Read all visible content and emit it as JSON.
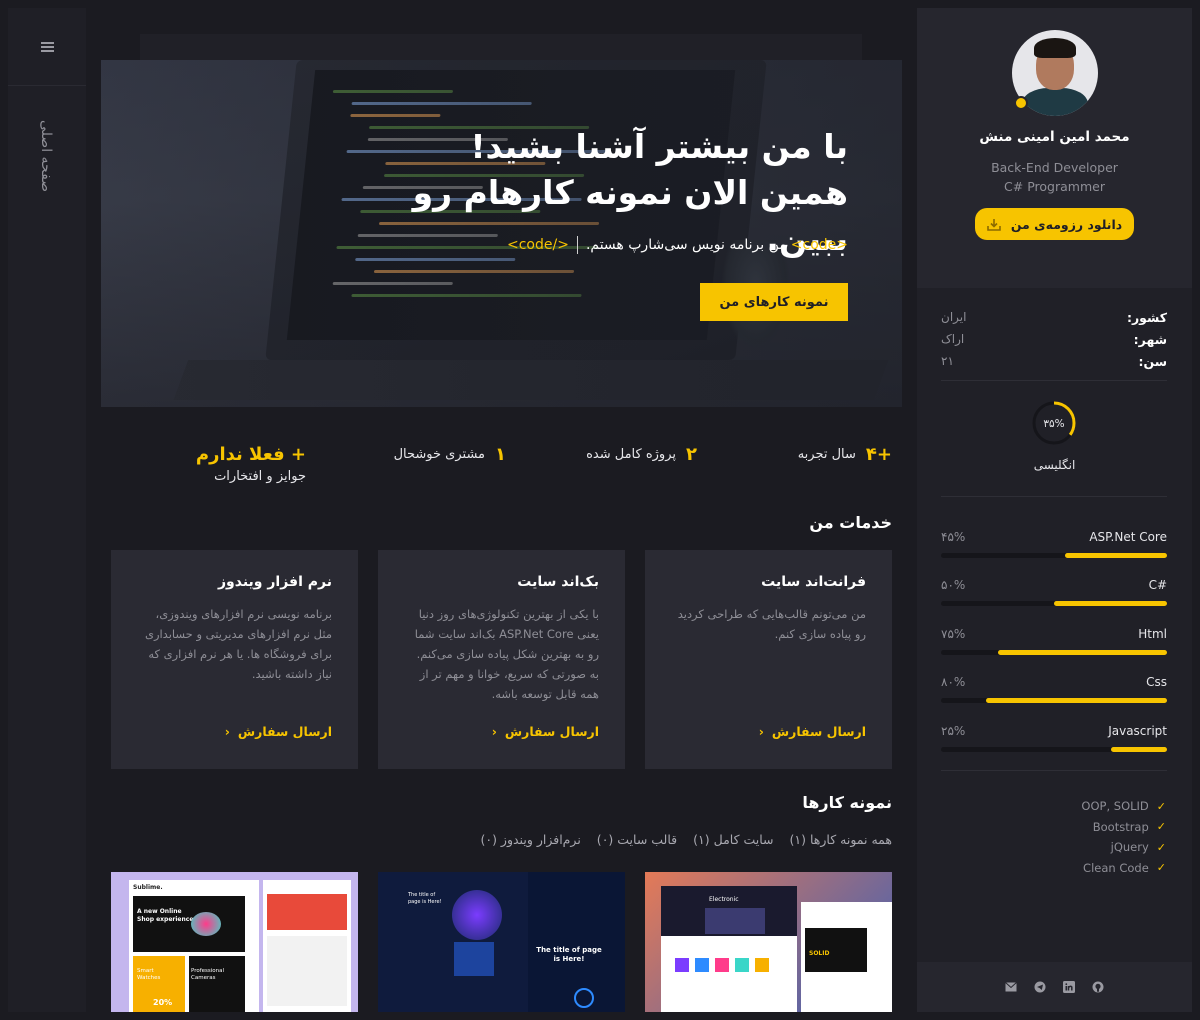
{
  "sidebar": {
    "home_label": "صفحه اصلی"
  },
  "hero": {
    "title": "با من بیشتر آشنا بشید! همین الان نمونه کارهام رو ببین.",
    "tag_open": "<code>",
    "sub_text": "من برنامه نویس سی‌شارپ هستم.",
    "tag_close": "</code>",
    "cta": "نمونه کارهای من"
  },
  "stats": [
    {
      "num": "+۴",
      "label": "سال تجربه"
    },
    {
      "num": "۲",
      "label": "پروژه کامل شده"
    },
    {
      "num": "۱",
      "label": "مشتری خوشحال"
    }
  ],
  "awards": {
    "num": "+ فعلا ندارم",
    "label": "جوایز و افتخارات"
  },
  "services": {
    "heading": "خدمات من",
    "cards": [
      {
        "title": "فرانت‌اند سایت",
        "desc": "من می‌تونم قالب‌هایی که طراحی کردید رو پیاده سازی کنم.",
        "link": "ارسال سفارش"
      },
      {
        "title": "بک‌اند سایت",
        "desc": "با یکی از بهترین تکنولوژی‌های روز دنیا یعنی ASP.Net Core بک‌اند سایت شما رو به بهترین شکل پیاده سازی می‌کنم. به صورتی که سریع، خوانا و مهم تر از همه قابل توسعه باشه.",
        "link": "ارسال سفارش"
      },
      {
        "title": "نرم افزار ویندوز",
        "desc": "برنامه نویسی نرم افزارهای ویندوزی، مثل نرم افزارهای مدیریتی و حسابداری برای فروشگاه ها. یا هر نرم افزاری که نیاز داشته باشید.",
        "link": "ارسال سفارش"
      }
    ]
  },
  "portfolio": {
    "heading": "نمونه کارها",
    "filters": [
      "همه نمونه کارها (۱)",
      "سایت کامل (۱)",
      "قالب سایت (۰)",
      "نرم‌افزار ویندوز (۰)"
    ],
    "thumbs": [
      {
        "text_a": "Sublime.",
        "text_b": "A new Online Shop experience.",
        "text_c": "Smart Watches",
        "text_d": "Professional Cameras",
        "text_e": "20%"
      },
      {
        "text_a": "The title of page is Here!",
        "text_b": "The title of page is Here!"
      },
      {
        "text_a": "Electronic",
        "text_b": "SOLID"
      }
    ]
  },
  "profile": {
    "name": "محمد امین امینی منش",
    "role1": "Back-End Developer",
    "role2": "C# Programmer",
    "download": "دانلود رزومه‌ی من",
    "info": [
      {
        "k": "کشور:",
        "v": "ایران"
      },
      {
        "k": "شهر:",
        "v": "اراک"
      },
      {
        "k": "سن:",
        "v": "۲۱"
      }
    ],
    "language": {
      "pct_text": "۳۵%",
      "pct": 0.35,
      "label": "انگلیسی"
    },
    "skills": [
      {
        "name": "ASP.Net Core",
        "pct_text": "۴۵%",
        "pct": 0.45
      },
      {
        "name": "C#",
        "pct_text": "۵۰%",
        "pct": 0.5
      },
      {
        "name": "Html",
        "pct_text": "۷۵%",
        "pct": 0.75
      },
      {
        "name": "Css",
        "pct_text": "۸۰%",
        "pct": 0.8
      },
      {
        "name": "Javascript",
        "pct_text": "۲۵%",
        "pct": 0.25
      }
    ],
    "knowledge": [
      "OOP, SOLID",
      "Bootstrap",
      "jQuery",
      "Clean Code"
    ],
    "social": [
      "mail-icon",
      "telegram-icon",
      "linkedin-icon",
      "github-icon"
    ]
  },
  "colors": {
    "accent": "#f7c400",
    "bg": "#1b1b21",
    "panel": "#202027",
    "card": "#2a2a33"
  }
}
